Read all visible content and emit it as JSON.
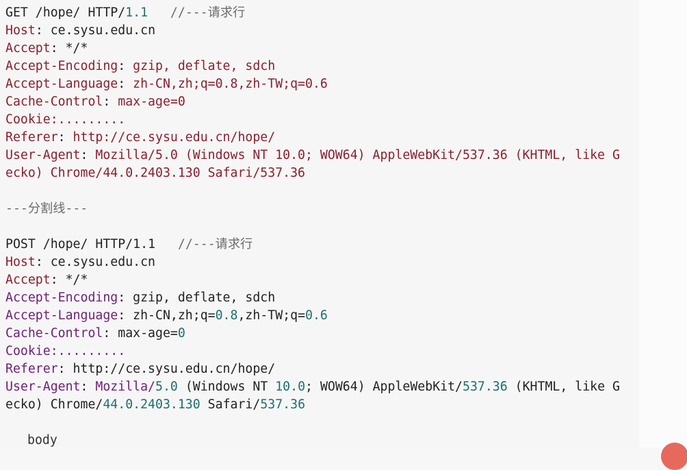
{
  "block1": {
    "request_line": "GET /hope/ HTTP/",
    "request_version": "1.1",
    "request_comment": "//---请求行",
    "host_key": "Host",
    "host_val": " ce.sysu.edu.cn",
    "accept_key": "Accept",
    "accept_val": " */*",
    "encoding_key": "Accept-Encoding",
    "encoding_val": " gzip, deflate, sdch",
    "language_key": "Accept-Language",
    "language_val": " zh-CN,zh;q=0.8,zh-TW;q=0.6",
    "cache_key": "Cache-Control",
    "cache_val": " max-age=0",
    "cookie_key": "Cookie",
    "cookie_val": ":.........",
    "referer_key": "Referer",
    "referer_val": " http://ce.sysu.edu.cn/hope/",
    "ua_key": "User-Agent",
    "ua_val_line1": " Mozilla/5.0 (Windows NT 10.0; WOW64) AppleWebKit/537.36 (KHTML, like G",
    "ua_val_line2": "ecko) Chrome/44.0.2403.130 Safari/537.36"
  },
  "separator": "---分割线---",
  "block2": {
    "method": "POST",
    "path": " /hope/ HTTP/",
    "version": "1.1",
    "comment": "//---请求行",
    "host_key": "Host",
    "host_val": ": ce.sysu.edu.cn",
    "accept_key": "Accept",
    "accept_val": ": */*",
    "encoding_key": "Accept-Encoding",
    "encoding_val": ": gzip, deflate, sdch",
    "language_key": "Accept-Language",
    "language_val_a": ": zh-CN,zh;q=",
    "language_num1": "0.8",
    "language_val_b": ",zh-TW;q=",
    "language_num2": "0.6",
    "cache_key": "Cache-Control",
    "cache_val_a": ": max-age=",
    "cache_num": "0",
    "cookie_key": "Cookie",
    "cookie_val": ":.........",
    "referer_key": "Referer",
    "referer_val": ": http://ce.sysu.edu.cn/hope/",
    "ua_key": "User-Agent",
    "ua_sep": ": ",
    "ua_val_1": "Mozilla/",
    "ua_num_1": "5.0",
    "ua_val_2": " (Windows NT ",
    "ua_num_2": "10.0",
    "ua_val_3": "; WOW64) AppleWebKit/",
    "ua_num_3": "537.36",
    "ua_val_4": " (KHTML, like G",
    "ua_line2_a": "ecko) Chrome/",
    "ua_line2_num1": "44.0.2403.130",
    "ua_line2_b": " Safari/",
    "ua_line2_num2": "537.36"
  },
  "trailing_text": "body"
}
